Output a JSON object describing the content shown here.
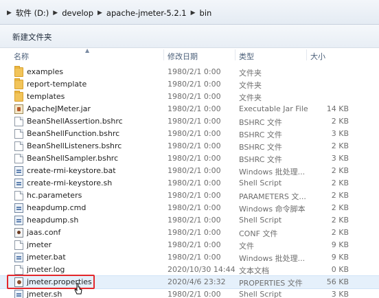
{
  "address": {
    "crumbs": [
      "软件 (D:)",
      "develop",
      "apache-jmeter-5.2.1",
      "bin"
    ]
  },
  "toolbar": {
    "new_folder_label": "新建文件夹"
  },
  "columns": {
    "name": "名称",
    "date": "修改日期",
    "type": "类型",
    "size": "大小"
  },
  "files": [
    {
      "name": "examples",
      "date": "1980/2/1 0:00",
      "type": "文件夹",
      "size": "",
      "icon": "folder-icon"
    },
    {
      "name": "report-template",
      "date": "1980/2/1 0:00",
      "type": "文件夹",
      "size": "",
      "icon": "folder-icon"
    },
    {
      "name": "templates",
      "date": "1980/2/1 0:00",
      "type": "文件夹",
      "size": "",
      "icon": "folder-icon"
    },
    {
      "name": "ApacheJMeter.jar",
      "date": "1980/2/1 0:00",
      "type": "Executable Jar File",
      "size": "14 KB",
      "icon": "jar-icon"
    },
    {
      "name": "BeanShellAssertion.bshrc",
      "date": "1980/2/1 0:00",
      "type": "BSHRC 文件",
      "size": "2 KB",
      "icon": "file-icon"
    },
    {
      "name": "BeanShellFunction.bshrc",
      "date": "1980/2/1 0:00",
      "type": "BSHRC 文件",
      "size": "3 KB",
      "icon": "file-icon"
    },
    {
      "name": "BeanShellListeners.bshrc",
      "date": "1980/2/1 0:00",
      "type": "BSHRC 文件",
      "size": "2 KB",
      "icon": "file-icon"
    },
    {
      "name": "BeanShellSampler.bshrc",
      "date": "1980/2/1 0:00",
      "type": "BSHRC 文件",
      "size": "3 KB",
      "icon": "file-icon"
    },
    {
      "name": "create-rmi-keystore.bat",
      "date": "1980/2/1 0:00",
      "type": "Windows 批处理...",
      "size": "2 KB",
      "icon": "script-icon"
    },
    {
      "name": "create-rmi-keystore.sh",
      "date": "1980/2/1 0:00",
      "type": "Shell Script",
      "size": "2 KB",
      "icon": "script-icon"
    },
    {
      "name": "hc.parameters",
      "date": "1980/2/1 0:00",
      "type": "PARAMETERS 文...",
      "size": "2 KB",
      "icon": "file-icon"
    },
    {
      "name": "heapdump.cmd",
      "date": "1980/2/1 0:00",
      "type": "Windows 命令脚本",
      "size": "2 KB",
      "icon": "script-icon"
    },
    {
      "name": "heapdump.sh",
      "date": "1980/2/1 0:00",
      "type": "Shell Script",
      "size": "2 KB",
      "icon": "script-icon"
    },
    {
      "name": "jaas.conf",
      "date": "1980/2/1 0:00",
      "type": "CONF 文件",
      "size": "2 KB",
      "icon": "conf-icon"
    },
    {
      "name": "jmeter",
      "date": "1980/2/1 0:00",
      "type": "文件",
      "size": "9 KB",
      "icon": "file-icon"
    },
    {
      "name": "jmeter.bat",
      "date": "1980/2/1 0:00",
      "type": "Windows 批处理...",
      "size": "9 KB",
      "icon": "script-icon"
    },
    {
      "name": "jmeter.log",
      "date": "2020/10/30 14:44",
      "type": "文本文档",
      "size": "0 KB",
      "icon": "file-icon"
    },
    {
      "name": "jmeter.properties",
      "date": "2020/4/6 23:32",
      "type": "PROPERTIES 文件",
      "size": "56 KB",
      "icon": "properties-icon",
      "selected": true
    },
    {
      "name": "jmeter.sh",
      "date": "1980/2/1 0:00",
      "type": "Shell Script",
      "size": "3 KB",
      "icon": "script-icon"
    }
  ]
}
